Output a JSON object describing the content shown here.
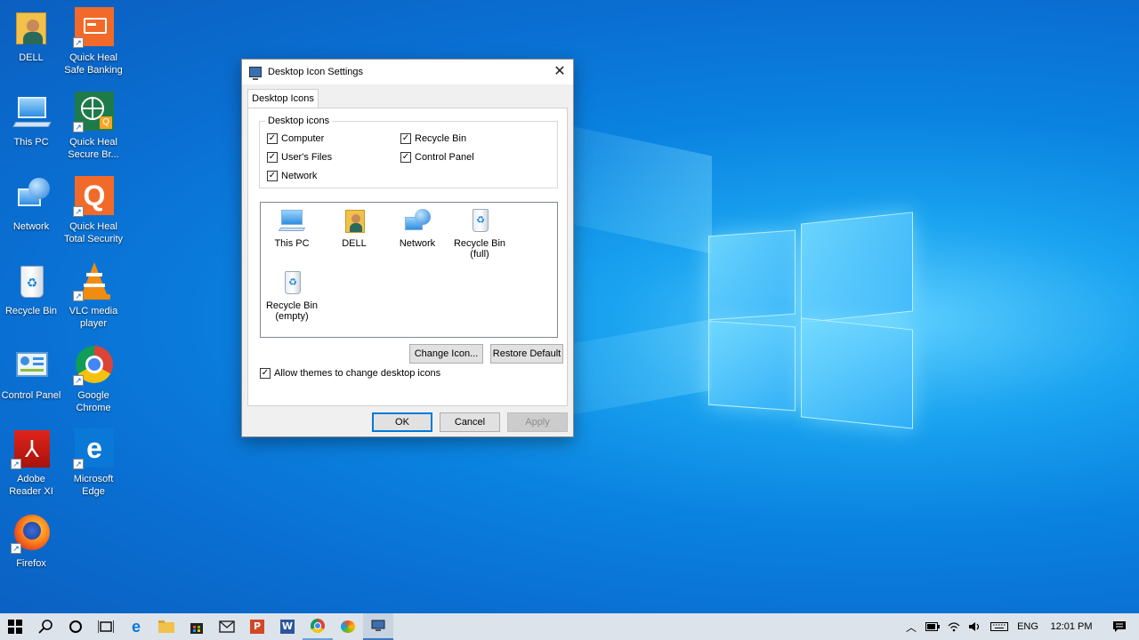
{
  "desktop": {
    "icons_col1": [
      {
        "label": "DELL"
      },
      {
        "label": "This PC"
      },
      {
        "label": "Network"
      },
      {
        "label": "Recycle Bin"
      },
      {
        "label": "Control Panel"
      },
      {
        "label": "Adobe Reader XI"
      },
      {
        "label": "Firefox"
      }
    ],
    "icons_col2": [
      {
        "label": "Quick Heal Safe Banking"
      },
      {
        "label": "Quick Heal Secure Br..."
      },
      {
        "label": "Quick Heal Total Security"
      },
      {
        "label": "VLC media player"
      },
      {
        "label": "Google Chrome"
      },
      {
        "label": "Microsoft Edge"
      }
    ]
  },
  "dialog": {
    "title": "Desktop Icon Settings",
    "close_glyph": "✕",
    "tab_label": "Desktop Icons",
    "group_label": "Desktop icons",
    "checkboxes": [
      {
        "label": "Computer",
        "checked": true
      },
      {
        "label": "Recycle Bin",
        "checked": true
      },
      {
        "label": "User's Files",
        "checked": true
      },
      {
        "label": "Control Panel",
        "checked": true
      },
      {
        "label": "Network",
        "checked": true
      }
    ],
    "icon_list": [
      {
        "label": "This PC"
      },
      {
        "label": "DELL"
      },
      {
        "label": "Network"
      },
      {
        "label": "Recycle Bin (full)"
      },
      {
        "label": "Recycle Bin (empty)"
      }
    ],
    "change_icon_label": "Change Icon...",
    "restore_default_label": "Restore Default",
    "allow_themes_label": "Allow themes to change desktop icons",
    "allow_themes_checked": true,
    "ok_label": "OK",
    "cancel_label": "Cancel",
    "apply_label": "Apply"
  },
  "taskbar": {
    "tray": {
      "language": "ENG",
      "time": "12:01 PM"
    }
  },
  "colors": {
    "accent": "#0078d7",
    "desktop_blue": "#0a83e0"
  }
}
